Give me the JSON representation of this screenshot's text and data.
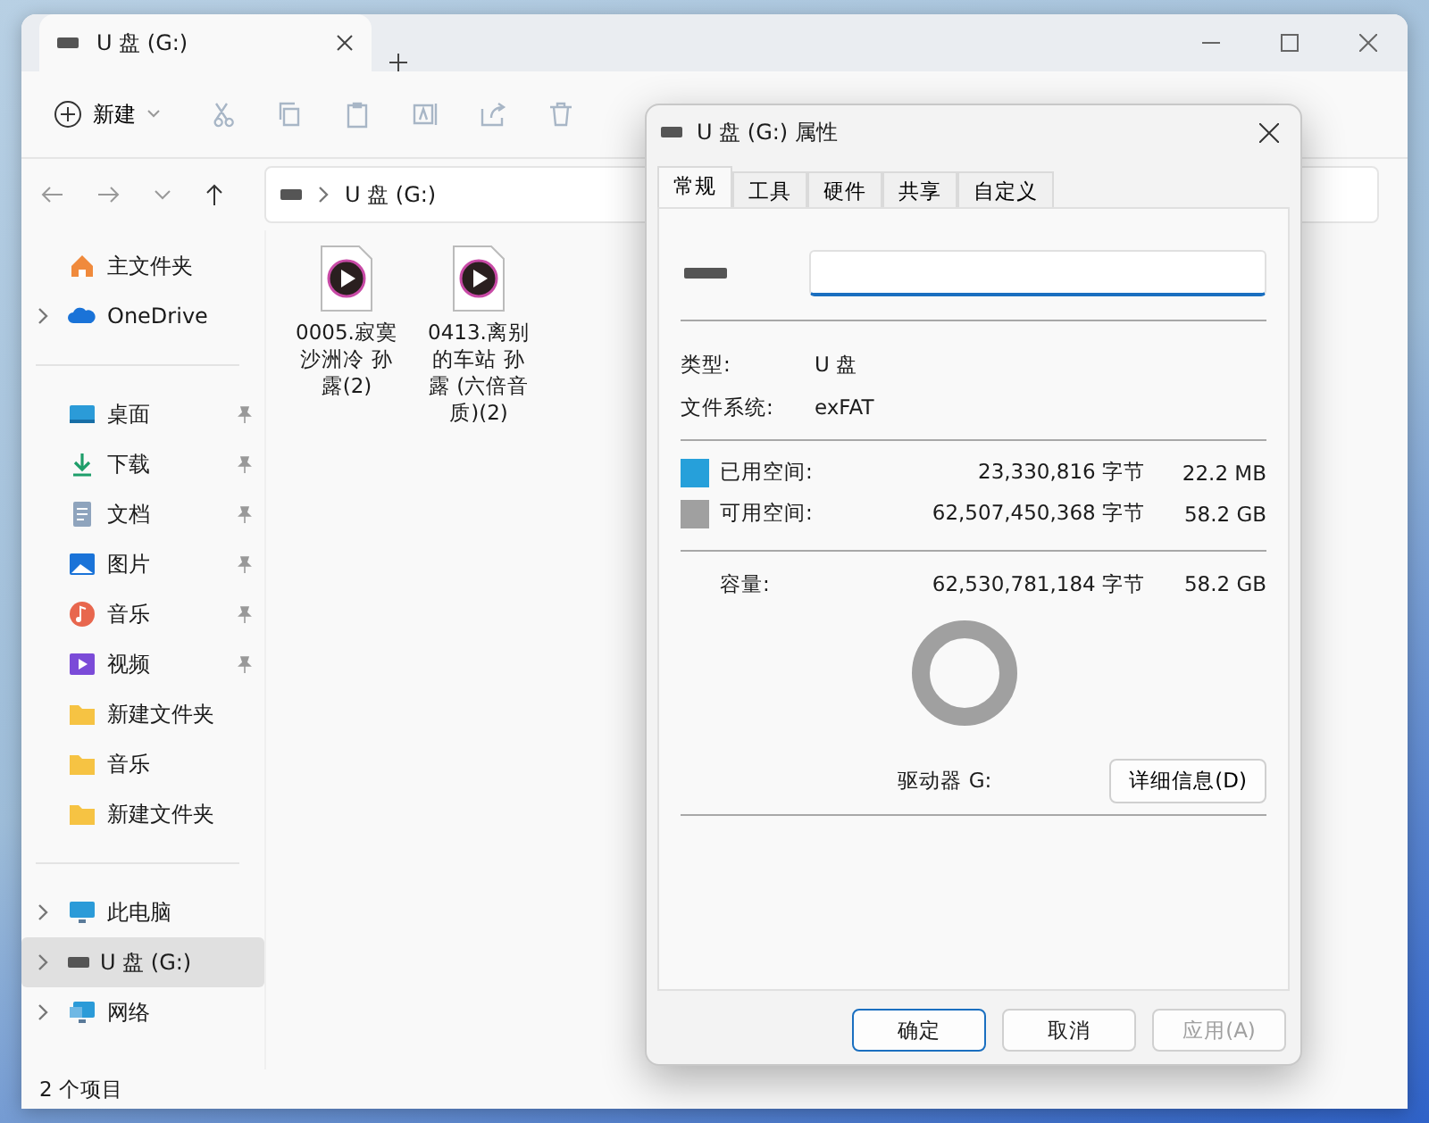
{
  "explorer": {
    "tab": {
      "title": "U 盘 (G:)",
      "selected": true
    },
    "toolbar": {
      "new_label": "新建"
    },
    "address": {
      "path": "U 盘 (G:)"
    },
    "sidebar": {
      "groups": [
        [
          {
            "kind": "home",
            "label": "主文件夹",
            "expandable": false,
            "pinned": false,
            "selected": false
          },
          {
            "kind": "cloud",
            "label": "OneDrive",
            "expandable": true,
            "pinned": false,
            "selected": false
          }
        ],
        [
          {
            "kind": "desktop",
            "label": "桌面",
            "expandable": false,
            "pinned": true,
            "selected": false
          },
          {
            "kind": "download",
            "label": "下载",
            "expandable": false,
            "pinned": true,
            "selected": false
          },
          {
            "kind": "documents",
            "label": "文档",
            "expandable": false,
            "pinned": true,
            "selected": false
          },
          {
            "kind": "pictures",
            "label": "图片",
            "expandable": false,
            "pinned": true,
            "selected": false
          },
          {
            "kind": "music",
            "label": "音乐",
            "expandable": false,
            "pinned": true,
            "selected": false
          },
          {
            "kind": "videos",
            "label": "视频",
            "expandable": false,
            "pinned": true,
            "selected": false
          },
          {
            "kind": "folder",
            "label": "新建文件夹",
            "expandable": false,
            "pinned": false,
            "selected": false
          },
          {
            "kind": "folder",
            "label": "音乐",
            "expandable": false,
            "pinned": false,
            "selected": false
          },
          {
            "kind": "folder",
            "label": "新建文件夹",
            "expandable": false,
            "pinned": false,
            "selected": false
          }
        ],
        [
          {
            "kind": "pc",
            "label": "此电脑",
            "expandable": true,
            "pinned": false,
            "selected": false
          },
          {
            "kind": "drive",
            "label": "U 盘 (G:)",
            "expandable": true,
            "pinned": false,
            "selected": true
          },
          {
            "kind": "network",
            "label": "网络",
            "expandable": true,
            "pinned": false,
            "selected": false
          }
        ]
      ]
    },
    "files": [
      {
        "name": "0005.寂寞沙洲冷 孙露(2)"
      },
      {
        "name": "0413.离别的车站 孙露 (六倍音质)(2)"
      }
    ],
    "status_bar": "2 个项目"
  },
  "dialog": {
    "title": "U 盘 (G:) 属性",
    "tabs": [
      {
        "label": "常规",
        "selected": true
      },
      {
        "label": "工具",
        "selected": false
      },
      {
        "label": "硬件",
        "selected": false
      },
      {
        "label": "共享",
        "selected": false
      },
      {
        "label": "自定义",
        "selected": false
      }
    ],
    "info": [
      {
        "label": "类型:",
        "value": "U 盘"
      },
      {
        "label": "文件系统:",
        "value": "exFAT"
      }
    ],
    "space": [
      {
        "label": "已用空间:",
        "bytes": "23,330,816 字节",
        "size": "22.2 MB",
        "color": "#26a0da"
      },
      {
        "label": "可用空间:",
        "bytes": "62,507,450,368 字节",
        "size": "58.2 GB",
        "color": "#a0a0a0"
      }
    ],
    "capacity": {
      "label": "容量:",
      "bytes": "62,530,781,184 字节",
      "size": "58.2 GB"
    },
    "drive_label": "驱动器 G:",
    "details_button": "详细信息(D)",
    "buttons": [
      {
        "label": "确定",
        "default": true,
        "disabled": false
      },
      {
        "label": "取消",
        "default": false,
        "disabled": false
      },
      {
        "label": "应用(A)",
        "default": false,
        "disabled": true
      }
    ]
  }
}
